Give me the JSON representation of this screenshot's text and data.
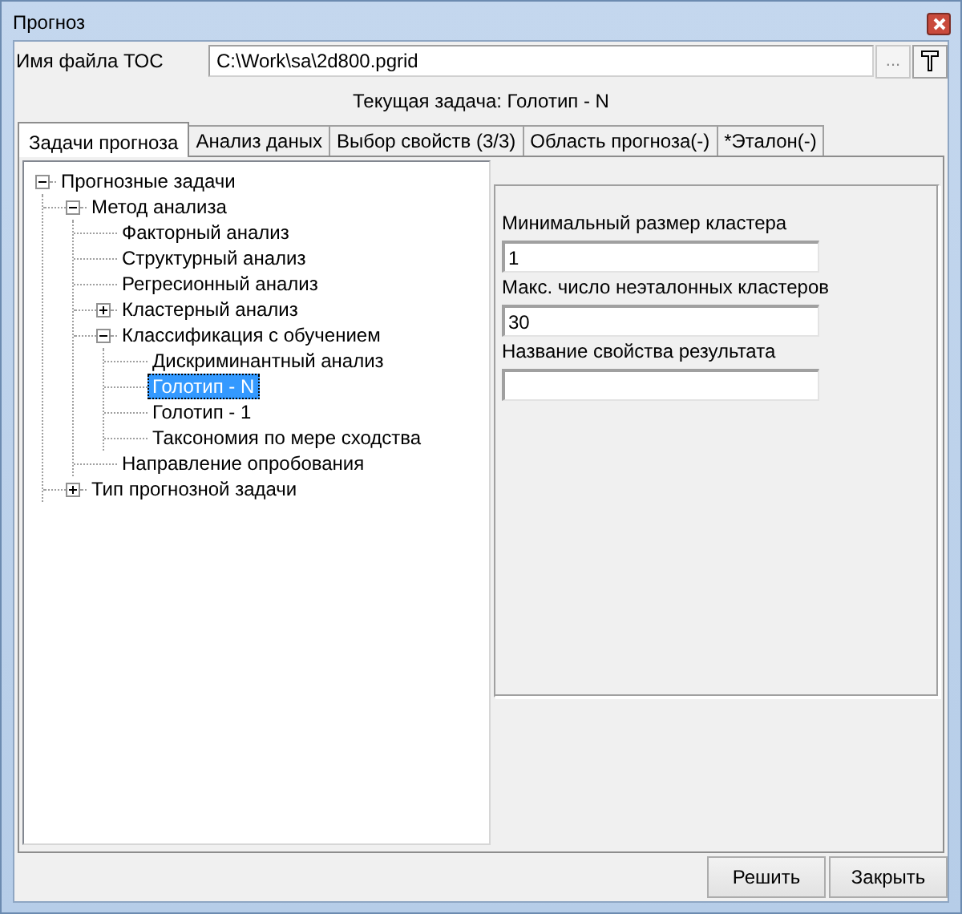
{
  "window": {
    "title": "Прогноз"
  },
  "file": {
    "label": "Имя файла ТОС",
    "value": "C:\\Work\\sa\\2d800.pgrid",
    "browse_label": "..."
  },
  "current_task": "Текущая задача: Голотип - N",
  "tabs": [
    {
      "label": "Задачи прогноза",
      "selected": true
    },
    {
      "label": "Анализ даных",
      "selected": false
    },
    {
      "label": "Выбор свойств (3/3)",
      "selected": false
    },
    {
      "label": "Область прогноза(-)",
      "selected": false
    },
    {
      "label": "*Эталон(-)",
      "selected": false
    }
  ],
  "tree": [
    {
      "label": "Прогнозные задачи",
      "selected": false,
      "expanded": true,
      "children": [
        {
          "label": "Метод анализа",
          "selected": false,
          "expanded": true,
          "children": [
            {
              "label": "Факторный анализ",
              "selected": false
            },
            {
              "label": "Структурный анализ",
              "selected": false
            },
            {
              "label": "Регресионный анализ",
              "selected": false
            },
            {
              "label": "Кластерный анализ",
              "selected": false,
              "expanded": false
            },
            {
              "label": "Классификация с обучением",
              "selected": false,
              "expanded": true,
              "children": [
                {
                  "label": "Дискриминантный анализ",
                  "selected": false
                },
                {
                  "label": "Голотип - N",
                  "selected": true
                },
                {
                  "label": "Голотип - 1",
                  "selected": false
                },
                {
                  "label": "Таксономия по мере сходства",
                  "selected": false
                }
              ]
            },
            {
              "label": "Направление опробования",
              "selected": false
            }
          ]
        },
        {
          "label": "Тип прогнозной задачи",
          "selected": false,
          "expanded": false
        }
      ]
    }
  ],
  "fields": [
    {
      "label": "Минимальный размер кластера",
      "value": "1"
    },
    {
      "label": "Макс. число неэталонных кластеров",
      "value": "30"
    },
    {
      "label": "Название свойства результата"
    }
  ],
  "buttons": [
    "Решить",
    "Закрыть"
  ]
}
